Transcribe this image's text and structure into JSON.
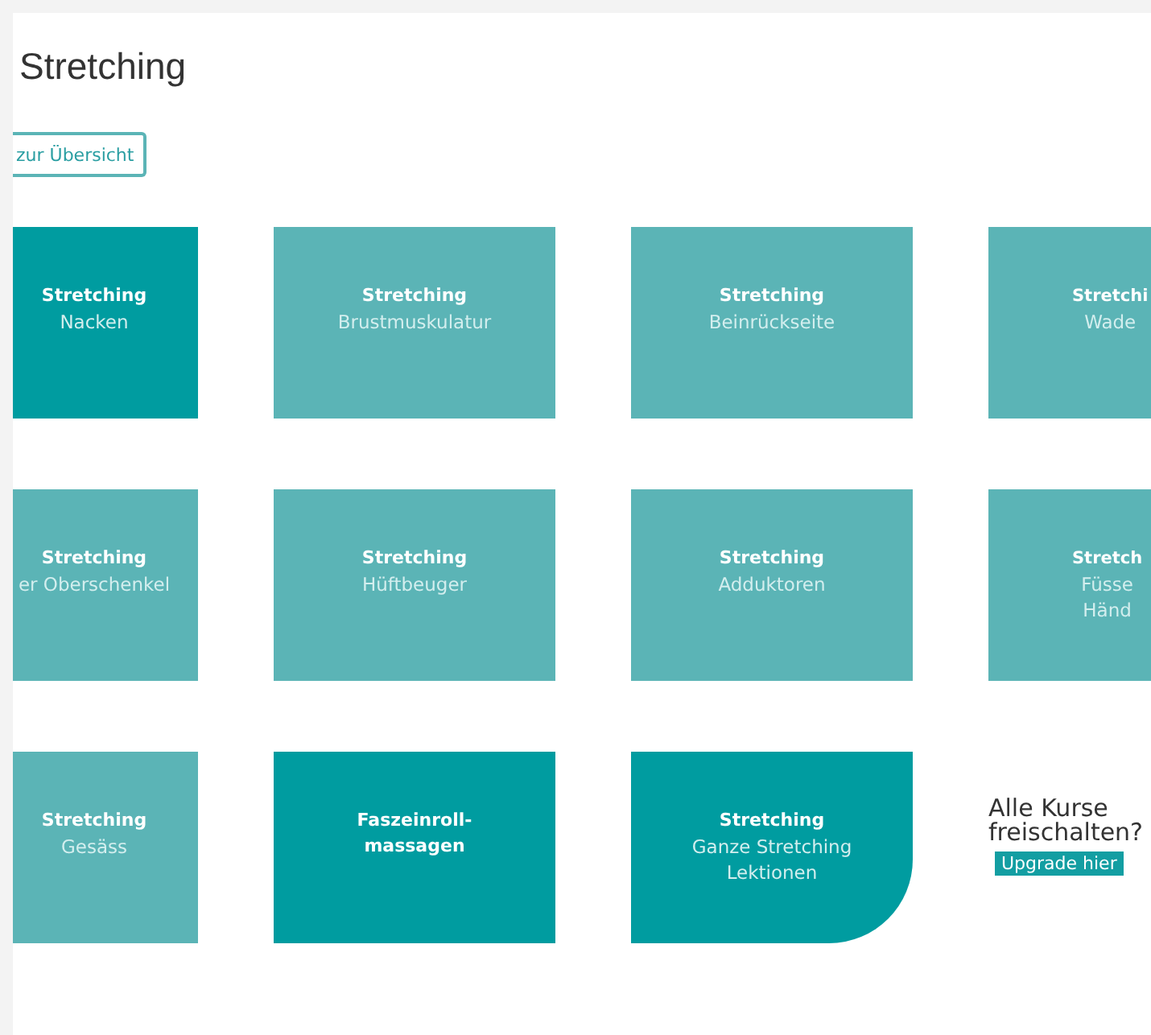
{
  "page": {
    "title": "Stretching",
    "back_button": "zur Übersicht"
  },
  "tiles": [
    {
      "kind": "tile",
      "color": "#009ca0",
      "title": "Stretching",
      "subtitle": [
        "Nacken"
      ]
    },
    {
      "kind": "tile",
      "color": "#5bb4b6",
      "title": "Stretching",
      "subtitle": [
        "Brustmuskulatur"
      ]
    },
    {
      "kind": "tile",
      "color": "#5bb4b6",
      "title": "Stretching",
      "subtitle": [
        "Beinrückseite"
      ]
    },
    {
      "kind": "tile",
      "color": "#5bb4b6",
      "title": "Stretchi",
      "subtitle": [
        "Wade"
      ]
    },
    {
      "kind": "tile",
      "color": "#5bb4b6",
      "title": "Stretching",
      "subtitle": [
        "er Oberschenkel"
      ]
    },
    {
      "kind": "tile",
      "color": "#5bb4b6",
      "title": "Stretching",
      "subtitle": [
        "Hüftbeuger"
      ]
    },
    {
      "kind": "tile",
      "color": "#5bb4b6",
      "title": "Stretching",
      "subtitle": [
        "Adduktoren"
      ]
    },
    {
      "kind": "tile",
      "color": "#5bb4b6",
      "title": "Stretch",
      "subtitle": [
        "Füsse",
        "Händ"
      ]
    },
    {
      "kind": "tile",
      "color": "#5bb4b6",
      "title": "Stretching",
      "subtitle": [
        "Gesäss"
      ]
    },
    {
      "kind": "tile",
      "color": "#009ca0",
      "title": "Faszeinroll-\nmassagen"
    },
    {
      "kind": "rounded-tile",
      "color": "#009ca0",
      "title": "Stretching",
      "subtitle": [
        "Ganze Stretching",
        "Lektionen"
      ]
    },
    {
      "kind": "promo",
      "heading": "Alle Kurse freischalten?",
      "button": "Upgrade hier"
    }
  ]
}
